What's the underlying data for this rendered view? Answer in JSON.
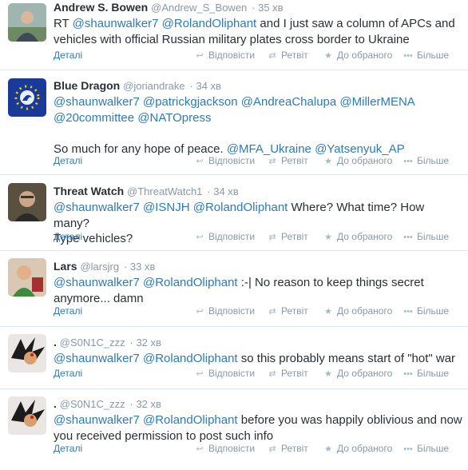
{
  "actions": {
    "details": "Деталі",
    "reply": "Відповісти",
    "retweet": "Ретвіт",
    "favorite": "До обраного",
    "more": "Більше"
  },
  "tweets": [
    {
      "fullname": "Andrew S. Bowen",
      "handle": "@Andrew_S_Bowen",
      "time": "· 35 хв",
      "lines": [
        [
          {
            "t": "RT "
          },
          {
            "t": "@shaunwalker7",
            "m": true
          },
          {
            "t": " "
          },
          {
            "t": "@RolandOliphant",
            "m": true
          },
          {
            "t": " and I just saw a column of APCs and"
          }
        ],
        [
          {
            "t": "vehicles with official Russian military plates cross border to Ukraine"
          }
        ]
      ]
    },
    {
      "fullname": "Blue Dragon",
      "handle": "@joriandrake",
      "time": "· 34 хв",
      "lines": [
        [
          {
            "t": "@shaunwalker7",
            "m": true
          },
          {
            "t": " "
          },
          {
            "t": "@patrickgjackson",
            "m": true
          },
          {
            "t": " "
          },
          {
            "t": "@AndreaChalupa",
            "m": true
          },
          {
            "t": " "
          },
          {
            "t": "@MillerMENA",
            "m": true
          }
        ],
        [
          {
            "t": "@20committee",
            "m": true
          },
          {
            "t": " "
          },
          {
            "t": "@NATOpress",
            "m": true
          }
        ],
        [
          {
            "t": " "
          }
        ],
        [
          {
            "t": "So much for any hope of peace. "
          },
          {
            "t": "@MFA_Ukraine",
            "m": true
          },
          {
            "t": " "
          },
          {
            "t": "@Yatsenyuk_AP",
            "m": true
          }
        ]
      ]
    },
    {
      "fullname": "Threat Watch",
      "handle": "@ThreatWatch1",
      "time": "· 34 хв",
      "lines": [
        [
          {
            "t": "@shaunwalker7",
            "m": true
          },
          {
            "t": " "
          },
          {
            "t": "@ISNJH",
            "m": true
          },
          {
            "t": " "
          },
          {
            "t": "@RolandOliphant",
            "m": true
          },
          {
            "t": " Where? What time? How many?"
          }
        ],
        [
          {
            "t": "Type vehicles?"
          }
        ]
      ]
    },
    {
      "fullname": "Lars",
      "handle": "@larsjrg",
      "time": "· 33 хв",
      "lines": [
        [
          {
            "t": "@shaunwalker7",
            "m": true
          },
          {
            "t": " "
          },
          {
            "t": "@RolandOliphant",
            "m": true
          },
          {
            "t": " :-| No reason to keep things secret"
          }
        ],
        [
          {
            "t": "anymore... damn"
          }
        ]
      ]
    },
    {
      "fullname": ".",
      "handle": "@S0N1C_zzz",
      "time": "· 32 хв",
      "lines": [
        [
          {
            "t": "@shaunwalker7",
            "m": true
          },
          {
            "t": " "
          },
          {
            "t": "@RolandOliphant",
            "m": true
          },
          {
            "t": " so this probably means start of \"hot\" war"
          }
        ]
      ]
    },
    {
      "fullname": ".",
      "handle": "@S0N1C_zzz",
      "time": "· 32 хв",
      "lines": [
        [
          {
            "t": "@shaunwalker7",
            "m": true
          },
          {
            "t": " "
          },
          {
            "t": "@RolandOliphant",
            "m": true
          },
          {
            "t": " before you was happily oblivious and now"
          }
        ],
        [
          {
            "t": "you received permission to post such info"
          }
        ]
      ]
    }
  ]
}
